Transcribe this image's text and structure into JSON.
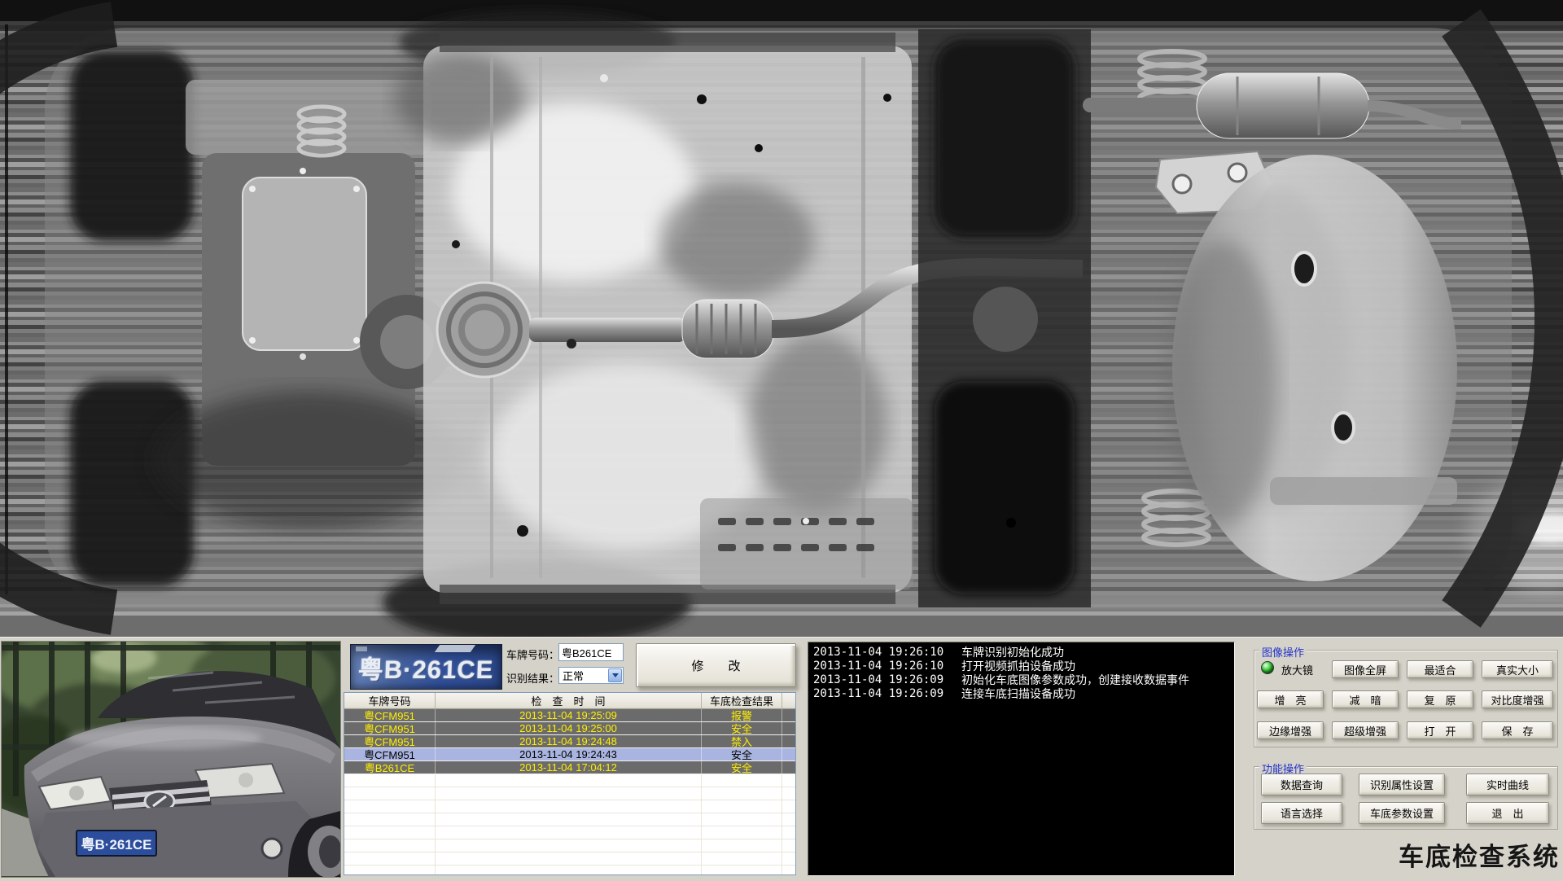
{
  "recognition": {
    "plate_crop_text": "粤B·261CE",
    "plate_label": "车牌号码：",
    "plate_value": "粤B261CE",
    "result_label": "识别结果：",
    "result_value": "正常",
    "modify_button": "修　　改"
  },
  "history_table": {
    "columns": [
      "车牌号码",
      "检　查　时　间",
      "车底检查结果"
    ],
    "rows": [
      {
        "plate": "粤CFM951",
        "time": "2013-11-04 19:25:09",
        "result": "报警",
        "state": "alarm"
      },
      {
        "plate": "粤CFM951",
        "time": "2013-11-04 19:25:00",
        "result": "安全",
        "state": "safe"
      },
      {
        "plate": "粤CFM951",
        "time": "2013-11-04 19:24:48",
        "result": "禁入",
        "state": "deny"
      },
      {
        "plate": "粤CFM951",
        "time": "2013-11-04 19:24:43",
        "result": "安全",
        "state": "selected"
      },
      {
        "plate": "粤B261CE",
        "time": "2013-11-04 17:04:12",
        "result": "安全",
        "state": "safe"
      }
    ]
  },
  "log": {
    "entries": [
      {
        "time": "2013-11-04 19:26:10",
        "message": "车牌识别初始化成功"
      },
      {
        "time": "2013-11-04 19:26:10",
        "message": "打开视频抓拍设备成功"
      },
      {
        "time": "2013-11-04 19:26:09",
        "message": "初始化车底图像参数成功，创建接收数据事件"
      },
      {
        "time": "2013-11-04 19:26:09",
        "message": "连接车底扫描设备成功"
      }
    ]
  },
  "image_ops": {
    "group_label": "图像操作",
    "magnifier_label": "放大镜",
    "row1": [
      "图像全屏",
      "最适合",
      "真实大小"
    ],
    "row2": [
      "增　亮",
      "减　暗",
      "复　原",
      "对比度增强"
    ],
    "row3": [
      "边缘增强",
      "超级增强",
      "打　开",
      "保　存"
    ]
  },
  "function_ops": {
    "group_label": "功能操作",
    "row1": [
      "数据查询",
      "识别属性设置",
      "实时曲线"
    ],
    "row2": [
      "语言选择",
      "车底参数设置",
      "退　出"
    ]
  },
  "vehicle_photo": {
    "plate_text": "粤B·261CE"
  },
  "system_title": "车底检查系统",
  "colors": {
    "panel_bg": "#d5d2c9",
    "group_label_blue": "#2433cc",
    "table_row_dark": "#6b6b6b",
    "table_row_text": "#ffee00",
    "table_row_selected": "#a9b4e0",
    "log_bg": "#000000",
    "plate_blue": "#31509a",
    "led_green": "#1ba31b"
  }
}
